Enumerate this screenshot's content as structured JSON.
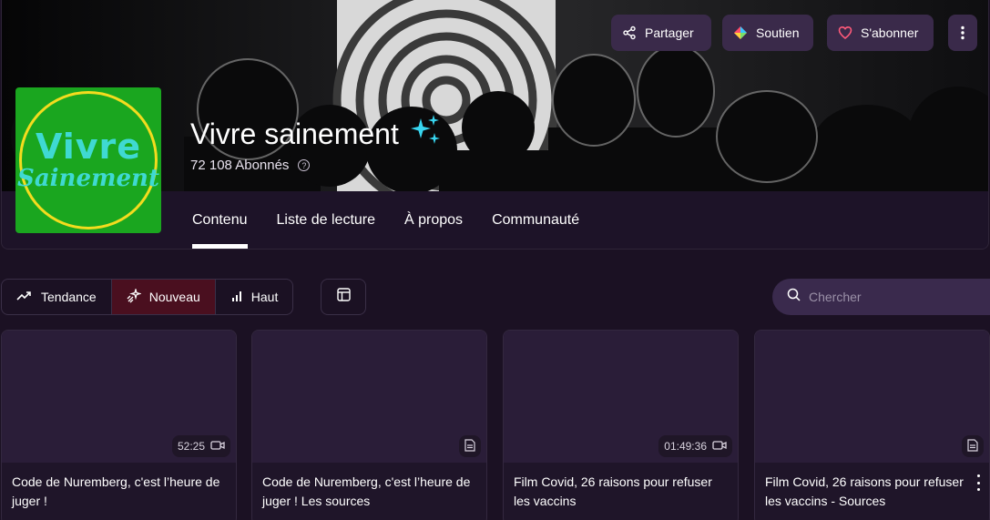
{
  "header": {
    "actions": {
      "share_label": "Partager",
      "support_label": "Soutien",
      "subscribe_label": "S'abonner"
    },
    "avatar": {
      "line1": "Vivre",
      "line2": "Sainement"
    },
    "channel_name": "Vivre sainement",
    "subscribers": "72 108 Abonnés",
    "tabs": [
      {
        "label": "Contenu",
        "active": true
      },
      {
        "label": "Liste de lecture",
        "active": false
      },
      {
        "label": "À propos",
        "active": false
      },
      {
        "label": "Communauté",
        "active": false
      }
    ]
  },
  "filters": {
    "items": [
      {
        "label": "Tendance",
        "icon": "trending-icon",
        "active": false
      },
      {
        "label": "Nouveau",
        "icon": "sparkle-icon",
        "active": true
      },
      {
        "label": "Haut",
        "icon": "bar-chart-icon",
        "active": false
      }
    ]
  },
  "search": {
    "placeholder": "Chercher",
    "value": ""
  },
  "cards": [
    {
      "title": "Code de Nuremberg, c'est l’heure de juger !",
      "duration": "52:25",
      "type": "video"
    },
    {
      "title": "Code de Nuremberg, c'est l’heure de juger ! Les sources",
      "duration": "",
      "type": "document"
    },
    {
      "title": "Film Covid, 26 raisons pour refuser les vaccins",
      "duration": "01:49:36",
      "type": "video"
    },
    {
      "title": "Film Covid, 26 raisons pour refuser les vaccins - Sources",
      "duration": "",
      "type": "document"
    }
  ],
  "colors": {
    "background": "#1b1123",
    "button": "#3a2a4a",
    "active_filter": "#4a0f1f",
    "avatar_green": "#1aa61f",
    "avatar_ring": "#f3dc1e",
    "avatar_text": "#3fd9d2",
    "sparkle": "#38d6f0"
  }
}
